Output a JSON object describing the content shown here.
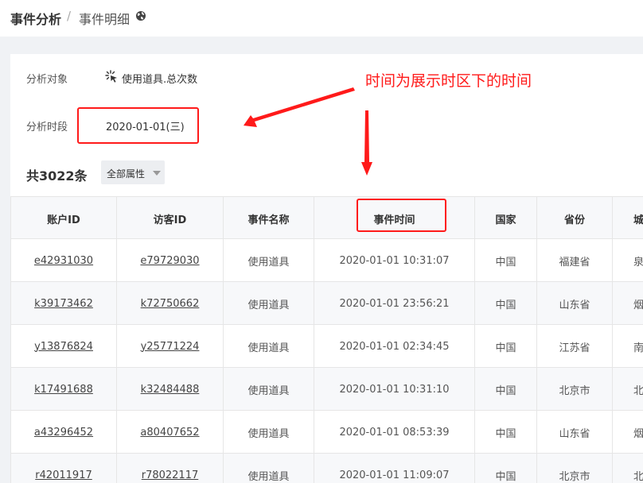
{
  "breadcrumb": {
    "current": "事件分析",
    "separator": "/",
    "sub": "事件明细"
  },
  "icons": {
    "globe": "globe-icon",
    "event_target": "sparkle-cursor-icon",
    "dropdown_arrow": "caret-down-icon"
  },
  "filters": {
    "target_label": "分析对象",
    "target_value": "使用道具.总次数",
    "period_label": "分析时段",
    "period_value": "2020-01-01(三)"
  },
  "annotation": "时间为展示时区下的时间",
  "summary": {
    "count": "共3022条",
    "attribute_dropdown": "全部属性"
  },
  "table": {
    "headers": [
      "账户ID",
      "访客ID",
      "事件名称",
      "事件时间",
      "国家",
      "省份",
      "城"
    ],
    "rows": [
      [
        "e42931030",
        "e79729030",
        "使用道具",
        "2020-01-01 10:31:07",
        "中国",
        "福建省",
        "泉"
      ],
      [
        "k39173462",
        "k72750662",
        "使用道具",
        "2020-01-01 23:56:21",
        "中国",
        "山东省",
        "烟"
      ],
      [
        "y13876824",
        "y25771224",
        "使用道具",
        "2020-01-01 02:34:45",
        "中国",
        "江苏省",
        "南"
      ],
      [
        "k17491688",
        "k32484488",
        "使用道具",
        "2020-01-01 10:31:10",
        "中国",
        "北京市",
        "北"
      ],
      [
        "a43296452",
        "a80407652",
        "使用道具",
        "2020-01-01 08:53:39",
        "中国",
        "山东省",
        "烟"
      ],
      [
        "r42011917",
        "r78022117",
        "使用道具",
        "2020-01-01 11:09:07",
        "中国",
        "北京市",
        "北"
      ]
    ]
  },
  "colors": {
    "annotation": "#ff1a1a",
    "header_bg": "#f7f8fa",
    "page_bg": "#f0f2f5"
  }
}
